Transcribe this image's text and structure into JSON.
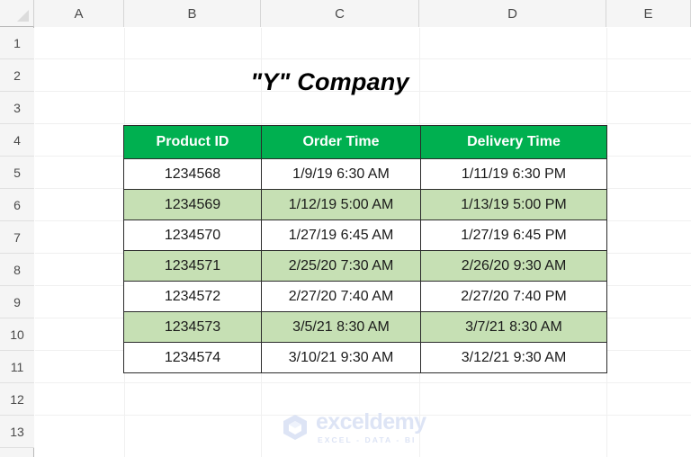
{
  "spreadsheet": {
    "column_headers": [
      "A",
      "B",
      "C",
      "D",
      "E"
    ],
    "row_headers": [
      "1",
      "2",
      "3",
      "4",
      "5",
      "6",
      "7",
      "8",
      "9",
      "10",
      "11",
      "12",
      "13"
    ]
  },
  "title": "\"Y\" Company",
  "colors": {
    "header_green": "#00B050",
    "alt_row_green": "#C6E0B4",
    "border": "#2B2B2B",
    "header_text": "#FFFFFF",
    "watermark": "#DDE4F5"
  },
  "table": {
    "headers": [
      "Product ID",
      "Order Time",
      "Delivery Time"
    ],
    "rows": [
      {
        "product_id": "1234568",
        "order_time": "1/9/19 6:30 AM",
        "delivery_time": "1/11/19 6:30 PM"
      },
      {
        "product_id": "1234569",
        "order_time": "1/12/19 5:00 AM",
        "delivery_time": "1/13/19 5:00 PM"
      },
      {
        "product_id": "1234570",
        "order_time": "1/27/19 6:45 AM",
        "delivery_time": "1/27/19 6:45 PM"
      },
      {
        "product_id": "1234571",
        "order_time": "2/25/20 7:30 AM",
        "delivery_time": "2/26/20 9:30 AM"
      },
      {
        "product_id": "1234572",
        "order_time": "2/27/20 7:40 AM",
        "delivery_time": "2/27/20 7:40 PM"
      },
      {
        "product_id": "1234573",
        "order_time": "3/5/21 8:30 AM",
        "delivery_time": "3/7/21 8:30 AM"
      },
      {
        "product_id": "1234574",
        "order_time": "3/10/21 9:30 AM",
        "delivery_time": "3/12/21 9:30 AM"
      }
    ]
  },
  "watermark": {
    "name": "exceldemy",
    "tagline": "EXCEL - DATA - BI",
    "logo_icon": "cube-icon"
  }
}
